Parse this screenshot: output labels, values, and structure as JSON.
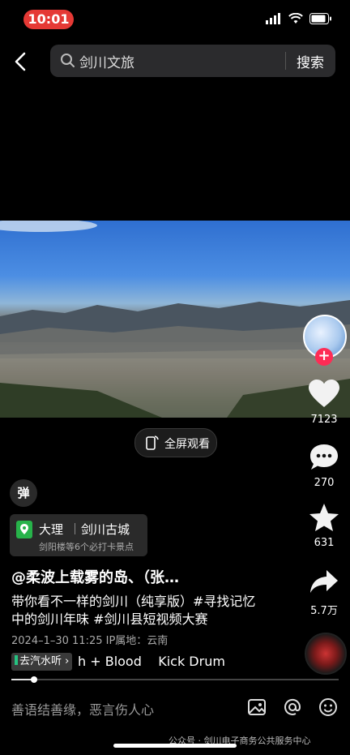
{
  "status_bar": {
    "time": "10:01"
  },
  "search": {
    "query": "剑川文旅",
    "button": "搜索"
  },
  "video": {
    "fullscreen_label": "全屏观看"
  },
  "rail": {
    "likes": "7123",
    "comments": "270",
    "favorites": "631",
    "shares": "5.7万"
  },
  "danmu": {
    "label": "弹"
  },
  "location": {
    "city": "大理",
    "spot": "剑川古城",
    "sub": "剑阳楼等6个必打卡景点"
  },
  "post": {
    "author": "@柔波上载雾的岛、（张…",
    "line1": "带你看不一样的剑川（纯享版）#寻找记忆",
    "line2": "中的剑川年味 #剑川县短视频大赛",
    "meta": "2024–1–30 11:25  IP属地：云南"
  },
  "music": {
    "tag": "去汽水听 ›",
    "title": "h + Blood    Kick Drum"
  },
  "progress": {
    "fraction": 0.07
  },
  "comment": {
    "placeholder": "善语结善缘，恶言伤人心"
  },
  "watermark": "公众号 · 剑川电子商务公共服务中心",
  "colors": {
    "accent_red": "#fe2c55",
    "time_pill": "#e53935"
  }
}
